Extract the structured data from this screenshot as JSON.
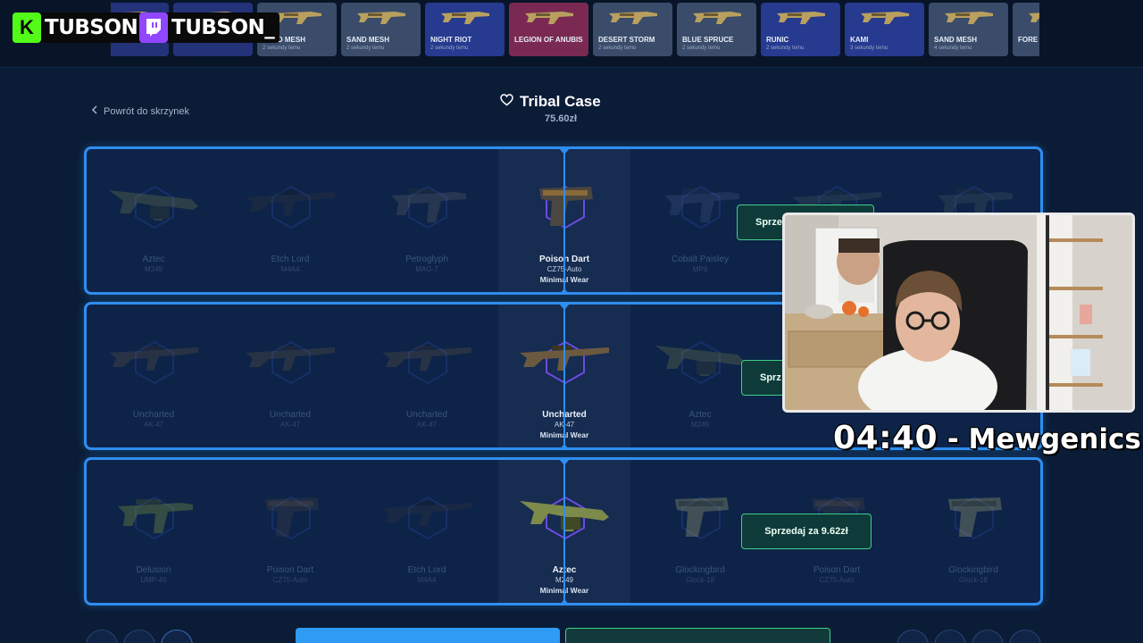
{
  "streamer": {
    "kick_name": "TUBSON",
    "twitch_name": "TUBSON_",
    "kick_color": "#53fc18",
    "twitch_color": "#9146ff"
  },
  "feed": [
    {
      "name": "",
      "time": "",
      "color": "#24327a"
    },
    {
      "name": "",
      "time": "",
      "color": "#24327a"
    },
    {
      "name": "SAND MESH",
      "time": "2 sekundy temu",
      "color": "#3a4c6a"
    },
    {
      "name": "SAND MESH",
      "time": "2 sekundy temu",
      "color": "#3a4c6a"
    },
    {
      "name": "NIGHT RIOT",
      "time": "2 sekundy temu",
      "color": "#263a90"
    },
    {
      "name": "LEGION OF ANUBIS",
      "time": "",
      "color": "#7a2a52"
    },
    {
      "name": "DESERT STORM",
      "time": "2 sekundy temu",
      "color": "#3a4c6a"
    },
    {
      "name": "BLUE SPRUCE",
      "time": "2 sekundy temu",
      "color": "#3a4c6a"
    },
    {
      "name": "RUNIC",
      "time": "2 sekundy temu",
      "color": "#263a90"
    },
    {
      "name": "KAMI",
      "time": "3 sekundy temu",
      "color": "#263a90"
    },
    {
      "name": "SAND MESH",
      "time": "4 sekundy temu",
      "color": "#3a4c6a"
    },
    {
      "name": "FORE",
      "time": "",
      "color": "#3a4c6a"
    }
  ],
  "header": {
    "back_label": "Powrót do skrzynek",
    "case_title": "Tribal Case",
    "case_price": "75.60zł"
  },
  "spinners": [
    {
      "items": [
        {
          "skin": "Aztec",
          "weapon": "M249",
          "wear": ""
        },
        {
          "skin": "Etch Lord",
          "weapon": "M4A4",
          "wear": ""
        },
        {
          "skin": "Petroglyph",
          "weapon": "MAG-7",
          "wear": ""
        },
        {
          "skin": "Poison Dart",
          "weapon": "CZ75-Auto",
          "wear": "Minimal Wear"
        },
        {
          "skin": "Cobalt Paisley",
          "weapon": "MP9",
          "wear": ""
        },
        {
          "skin": "",
          "weapon": "",
          "wear": ""
        },
        {
          "skin": "",
          "weapon": "",
          "wear": ""
        }
      ],
      "sell_label": "Sprzedaj za"
    },
    {
      "items": [
        {
          "skin": "Uncharted",
          "weapon": "AK-47",
          "wear": ""
        },
        {
          "skin": "Uncharted",
          "weapon": "AK-47",
          "wear": ""
        },
        {
          "skin": "Uncharted",
          "weapon": "AK-47",
          "wear": ""
        },
        {
          "skin": "Uncharted",
          "weapon": "AK-47",
          "wear": "Minimal Wear"
        },
        {
          "skin": "Aztec",
          "weapon": "M249",
          "wear": ""
        },
        {
          "skin": "",
          "weapon": "",
          "wear": ""
        },
        {
          "skin": "",
          "weapon": "",
          "wear": ""
        }
      ],
      "sell_label": "Sprz"
    },
    {
      "items": [
        {
          "skin": "Delusion",
          "weapon": "UMP-45",
          "wear": ""
        },
        {
          "skin": "Poison Dart",
          "weapon": "CZ75-Auto",
          "wear": ""
        },
        {
          "skin": "Etch Lord",
          "weapon": "M4A4",
          "wear": ""
        },
        {
          "skin": "Aztec",
          "weapon": "M249",
          "wear": "Minimal Wear"
        },
        {
          "skin": "Glockingbird",
          "weapon": "Glock-18",
          "wear": ""
        },
        {
          "skin": "Poison Dart",
          "weapon": "CZ75-Auto",
          "wear": ""
        },
        {
          "skin": "Glockingbird",
          "weapon": "Glock-18",
          "wear": ""
        }
      ],
      "sell_label": "Sprzedaj za 9.62zł"
    }
  ],
  "overlay": {
    "timer": "04:40",
    "separator": " - ",
    "game": "Mewgenics"
  },
  "colors": {
    "accent": "#2f8ef0",
    "sell_border": "#3fd08a"
  }
}
